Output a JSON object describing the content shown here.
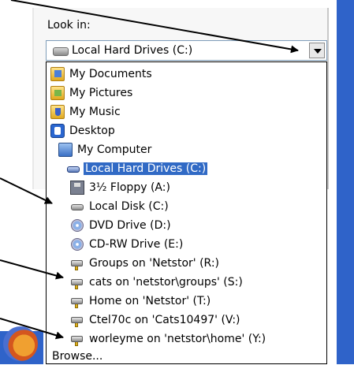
{
  "look_in": {
    "label": "Look in:",
    "selected": "Local Hard Drives (C:)"
  },
  "dropdown": {
    "items": [
      {
        "label": "My Documents",
        "icon": "my-documents-icon"
      },
      {
        "label": "My Pictures",
        "icon": "my-pictures-icon"
      },
      {
        "label": "My Music",
        "icon": "my-music-icon"
      },
      {
        "label": "Desktop",
        "icon": "desktop-icon"
      },
      {
        "label": "My Computer",
        "icon": "computer-icon"
      },
      {
        "label": "Local Hard Drives (C:)",
        "icon": "hard-drive-icon",
        "selected": true
      },
      {
        "label": "3½ Floppy (A:)",
        "icon": "floppy-icon"
      },
      {
        "label": "Local Disk (C:)",
        "icon": "hard-drive-icon"
      },
      {
        "label": "DVD Drive (D:)",
        "icon": "dvd-drive-icon"
      },
      {
        "label": "CD-RW Drive (E:)",
        "icon": "cd-drive-icon"
      },
      {
        "label": "Groups on 'Netstor' (R:)",
        "icon": "network-drive-icon"
      },
      {
        "label": "cats on 'netstor\\groups' (S:)",
        "icon": "network-drive-icon"
      },
      {
        "label": "Home on 'Netstor' (T:)",
        "icon": "network-drive-icon"
      },
      {
        "label": "Ctel70c on 'Cats10497' (V:)",
        "icon": "network-drive-icon"
      },
      {
        "label": "worleyme on 'netstor\\home' (Y:)",
        "icon": "network-drive-icon"
      },
      {
        "label": "Browse...",
        "icon": ""
      }
    ]
  },
  "colors": {
    "selection": "#316ac5",
    "taskbar_blue": "#2f63c9"
  }
}
